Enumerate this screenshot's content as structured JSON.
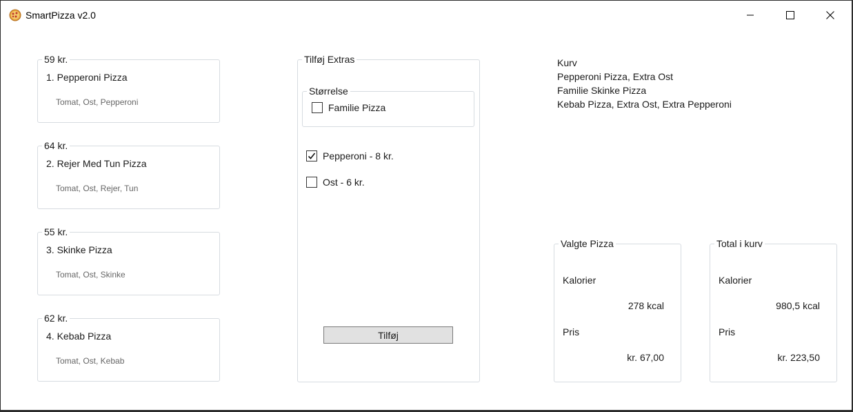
{
  "app": {
    "title": "SmartPizza v2.0",
    "icon": "pizza-icon"
  },
  "pizzas": [
    {
      "price": "59 kr.",
      "name": "1. Pepperoni Pizza",
      "ingredients": "Tomat, Ost, Pepperoni"
    },
    {
      "price": "64 kr.",
      "name": "2. Rejer Med Tun Pizza",
      "ingredients": "Tomat, Ost, Rejer, Tun"
    },
    {
      "price": "55 kr.",
      "name": "3. Skinke Pizza",
      "ingredients": "Tomat, Ost, Skinke"
    },
    {
      "price": "62 kr.",
      "name": "4. Kebab Pizza",
      "ingredients": "Tomat, Ost, Kebab"
    }
  ],
  "extras": {
    "title": "Tilføj Extras",
    "size_group": "Størrelse",
    "family_label": "Familie Pizza",
    "family_checked": false,
    "options": [
      {
        "label": "Pepperoni - 8 kr.",
        "checked": true
      },
      {
        "label": "Ost - 6 kr.",
        "checked": false
      }
    ],
    "add_button": "Tilføj"
  },
  "cart": {
    "title": "Kurv",
    "items": [
      "Pepperoni Pizza, Extra Ost",
      "Familie Skinke Pizza",
      "Kebab Pizza, Extra Ost, Extra Pepperoni"
    ]
  },
  "selected": {
    "title": "Valgte Pizza",
    "calories_label": "Kalorier",
    "calories_value": "278 kcal",
    "price_label": "Pris",
    "price_value": "kr. 67,00"
  },
  "total": {
    "title": "Total i kurv",
    "calories_label": "Kalorier",
    "calories_value": "980,5 kcal",
    "price_label": "Pris",
    "price_value": "kr. 223,50"
  }
}
